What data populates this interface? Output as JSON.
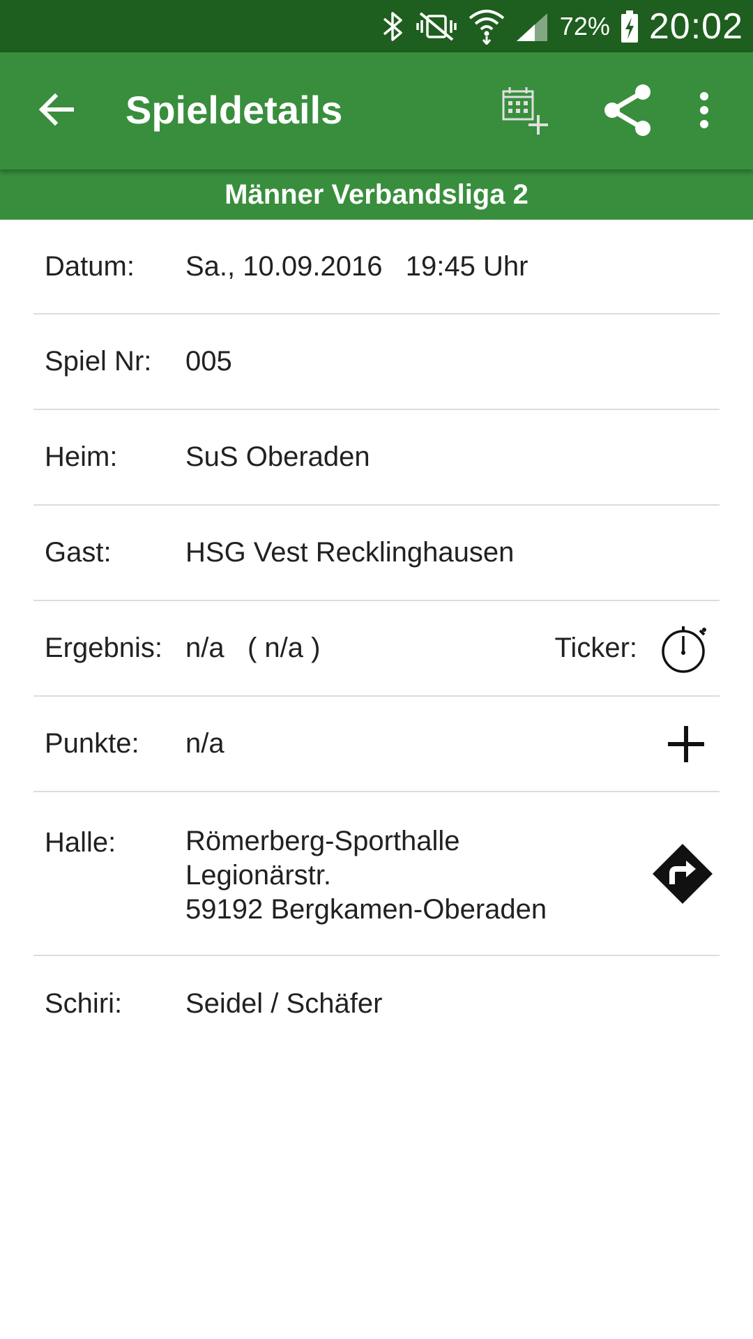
{
  "status_bar": {
    "battery_percent": "72%",
    "time": "20:02",
    "icons": [
      "bluetooth-icon",
      "vibrate-mute-icon",
      "wifi-icon",
      "signal-icon",
      "battery-charging-icon"
    ]
  },
  "app_bar": {
    "title": "Spieldetails",
    "icons": [
      "back-arrow-icon",
      "calendar-add-icon",
      "share-icon",
      "more-vert-icon"
    ]
  },
  "league": "Männer Verbandsliga 2",
  "details": {
    "datum": {
      "label": "Datum:",
      "value": "Sa., 10.09.2016   19:45 Uhr"
    },
    "spiel_nr": {
      "label": "Spiel Nr:",
      "value": "005"
    },
    "heim": {
      "label": "Heim:",
      "value": "SuS Oberaden"
    },
    "gast": {
      "label": "Gast:",
      "value": "HSG Vest Recklinghausen"
    },
    "ergebnis": {
      "label": "Ergebnis:",
      "value": "n/a   ( n/a )",
      "ticker_label": "Ticker:",
      "ticker_icon": "stopwatch-icon"
    },
    "punkte": {
      "label": "Punkte:",
      "value": "n/a",
      "add_icon": "plus-icon"
    },
    "halle": {
      "label": "Halle:",
      "name": "Römerberg-Sporthalle",
      "street": "Legionärstr.",
      "city": "59192 Bergkamen-Oberaden",
      "directions_icon": "directions-icon"
    },
    "schiri": {
      "label": "Schiri:",
      "value": "Seidel / Schäfer"
    }
  },
  "colors": {
    "status_bar": "#1e5e1e",
    "primary": "#388e3c",
    "divider": "#dcdcdc",
    "text": "#212121"
  }
}
